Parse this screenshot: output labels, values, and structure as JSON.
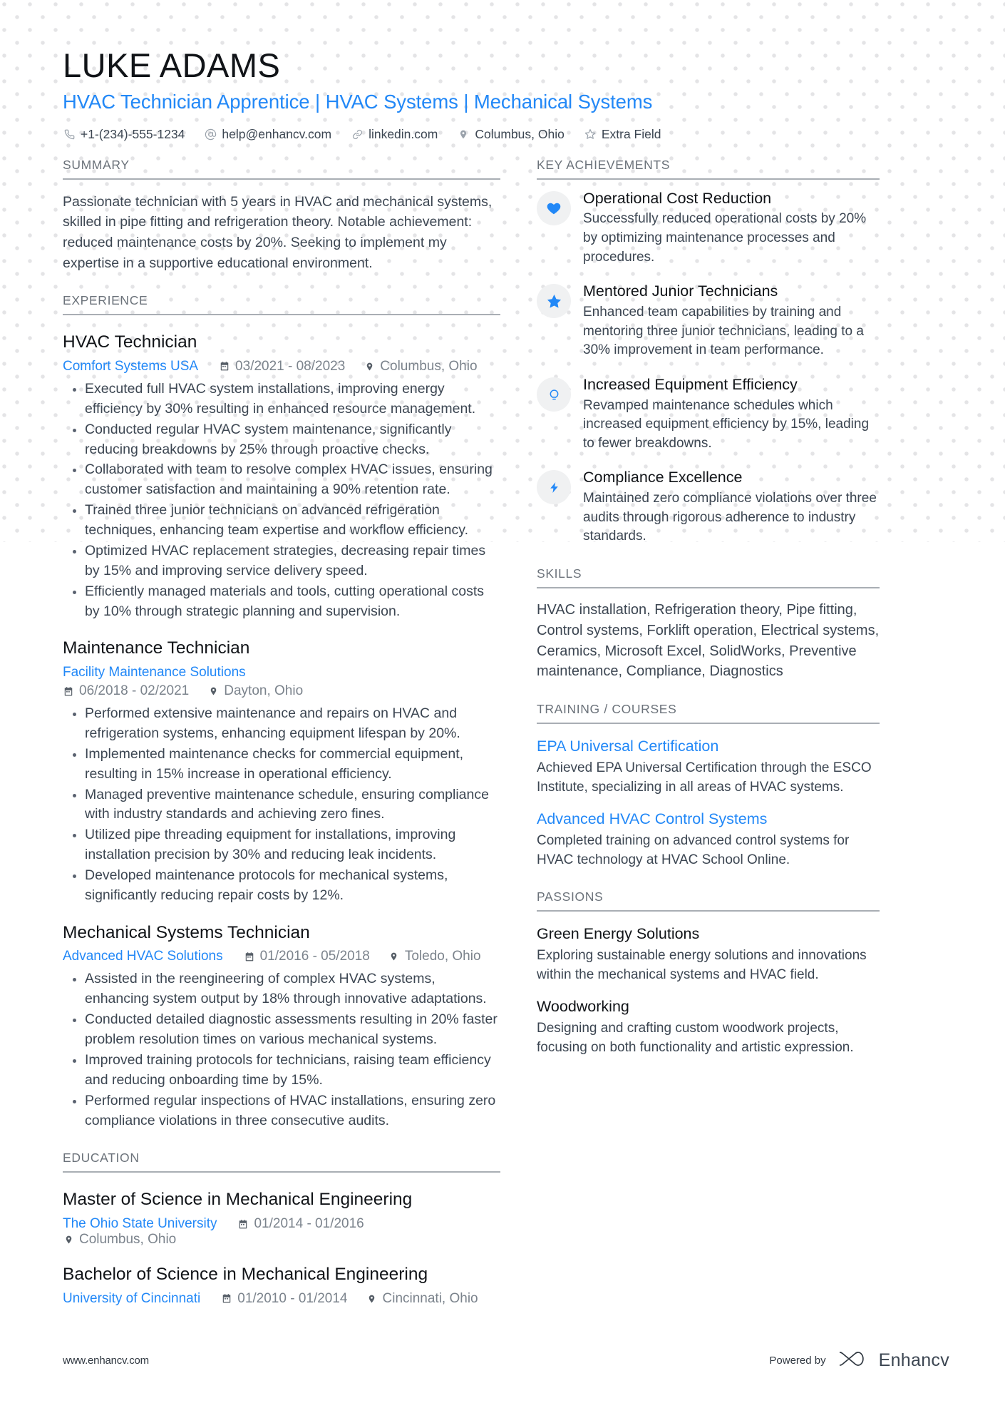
{
  "header": {
    "name": "LUKE ADAMS",
    "headline": "HVAC Technician Apprentice | HVAC Systems | Mechanical Systems",
    "contacts": [
      {
        "icon": "phone-icon",
        "text": "+1-(234)-555-1234"
      },
      {
        "icon": "email-icon",
        "text": "help@enhancv.com"
      },
      {
        "icon": "link-icon",
        "text": "linkedin.com"
      },
      {
        "icon": "location-pin-icon",
        "text": "Columbus, Ohio"
      },
      {
        "icon": "star-outline-icon",
        "text": "Extra Field"
      }
    ]
  },
  "colors": {
    "accent_blue": "#2288f7",
    "body_text": "#3c4652",
    "heading_text": "#111418",
    "section_rule": "#a9aeb4",
    "badge_bg": "#f0f1f2"
  },
  "left": {
    "summary": {
      "title": "SUMMARY",
      "text": "Passionate technician with 5 years in HVAC and mechanical systems, skilled in pipe fitting and refrigeration theory. Notable achievement: reduced maintenance costs by 20%. Seeking to implement my expertise in a supportive educational environment."
    },
    "experience": {
      "title": "EXPERIENCE",
      "entries": [
        {
          "role": "HVAC Technician",
          "org": "Comfort Systems USA",
          "dates": "03/2021 - 08/2023",
          "location": "Columbus, Ohio",
          "layout": "inline",
          "bullets": [
            "Executed full HVAC system installations, improving energy efficiency by 30% resulting in enhanced resource management.",
            "Conducted regular HVAC system maintenance, significantly reducing breakdowns by 25% through proactive checks.",
            "Collaborated with team to resolve complex HVAC issues, ensuring customer satisfaction and maintaining a 90% retention rate.",
            "Trained three junior technicians on advanced refrigeration techniques, enhancing team expertise and workflow efficiency.",
            "Optimized HVAC replacement strategies, decreasing repair times by 15% and improving service delivery speed.",
            "Efficiently managed materials and tools, cutting operational costs by 10% through strategic planning and supervision."
          ]
        },
        {
          "role": "Maintenance Technician",
          "org": "Facility Maintenance Solutions",
          "dates": "06/2018 - 02/2021",
          "location": "Dayton, Ohio",
          "layout": "stacked",
          "bullets": [
            "Performed extensive maintenance and repairs on HVAC and refrigeration systems, enhancing equipment lifespan by 20%.",
            "Implemented maintenance checks for commercial equipment, resulting in 15% increase in operational efficiency.",
            "Managed preventive maintenance schedule, ensuring compliance with industry standards and achieving zero fines.",
            "Utilized pipe threading equipment for installations, improving installation precision by 30% and reducing leak incidents.",
            "Developed maintenance protocols for mechanical systems, significantly reducing repair costs by 12%."
          ]
        },
        {
          "role": "Mechanical Systems Technician",
          "org": "Advanced HVAC Solutions",
          "dates": "01/2016 - 05/2018",
          "location": "Toledo, Ohio",
          "layout": "inline",
          "bullets": [
            "Assisted in the reengineering of complex HVAC systems, enhancing system output by 18% through innovative adaptations.",
            "Conducted detailed diagnostic assessments resulting in 20% faster problem resolution times on various mechanical systems.",
            "Improved training protocols for technicians, raising team efficiency and reducing onboarding time by 15%.",
            "Performed regular inspections of HVAC installations, ensuring zero compliance violations in three consecutive audits."
          ]
        }
      ]
    },
    "education": {
      "title": "EDUCATION",
      "entries": [
        {
          "degree": "Master of Science in Mechanical Engineering",
          "school": "The Ohio State University",
          "dates": "01/2014 - 01/2016",
          "location": "Columbus, Ohio"
        },
        {
          "degree": "Bachelor of Science in Mechanical Engineering",
          "school": "University of Cincinnati",
          "dates": "01/2010 - 01/2014",
          "location": "Cincinnati, Ohio"
        }
      ]
    }
  },
  "right": {
    "achievements": {
      "title": "KEY ACHIEVEMENTS",
      "items": [
        {
          "icon": "heart-icon",
          "title": "Operational Cost Reduction",
          "desc": "Successfully reduced operational costs by 20% by optimizing maintenance processes and procedures."
        },
        {
          "icon": "star-icon",
          "title": "Mentored Junior Technicians",
          "desc": "Enhanced team capabilities by training and mentoring three junior technicians, leading to a 30% improvement in team performance."
        },
        {
          "icon": "lightbulb-icon",
          "title": "Increased Equipment Efficiency",
          "desc": "Revamped maintenance schedules which increased equipment efficiency by 15%, leading to fewer breakdowns."
        },
        {
          "icon": "lightning-bolt-icon",
          "title": "Compliance Excellence",
          "desc": "Maintained zero compliance violations over three audits through rigorous adherence to industry standards."
        }
      ]
    },
    "skills": {
      "title": "SKILLS",
      "text": "HVAC installation, Refrigeration theory, Pipe fitting, Control systems, Forklift operation, Electrical systems, Ceramics, Microsoft Excel, SolidWorks, Preventive maintenance, Compliance, Diagnostics"
    },
    "training": {
      "title": "TRAINING / COURSES",
      "items": [
        {
          "name": "EPA Universal Certification",
          "desc": "Achieved EPA Universal Certification through the ESCO Institute, specializing in all areas of HVAC systems."
        },
        {
          "name": "Advanced HVAC Control Systems",
          "desc": "Completed training on advanced control systems for HVAC technology at HVAC School Online."
        }
      ]
    },
    "passions": {
      "title": "PASSIONS",
      "items": [
        {
          "name": "Green Energy Solutions",
          "desc": "Exploring sustainable energy solutions and innovations within the mechanical systems and HVAC field."
        },
        {
          "name": "Woodworking",
          "desc": "Designing and crafting custom woodwork projects, focusing on both functionality and artistic expression."
        }
      ]
    }
  },
  "footer": {
    "url": "www.enhancv.com",
    "powered_by": "Powered by",
    "brand": "Enhancv"
  }
}
